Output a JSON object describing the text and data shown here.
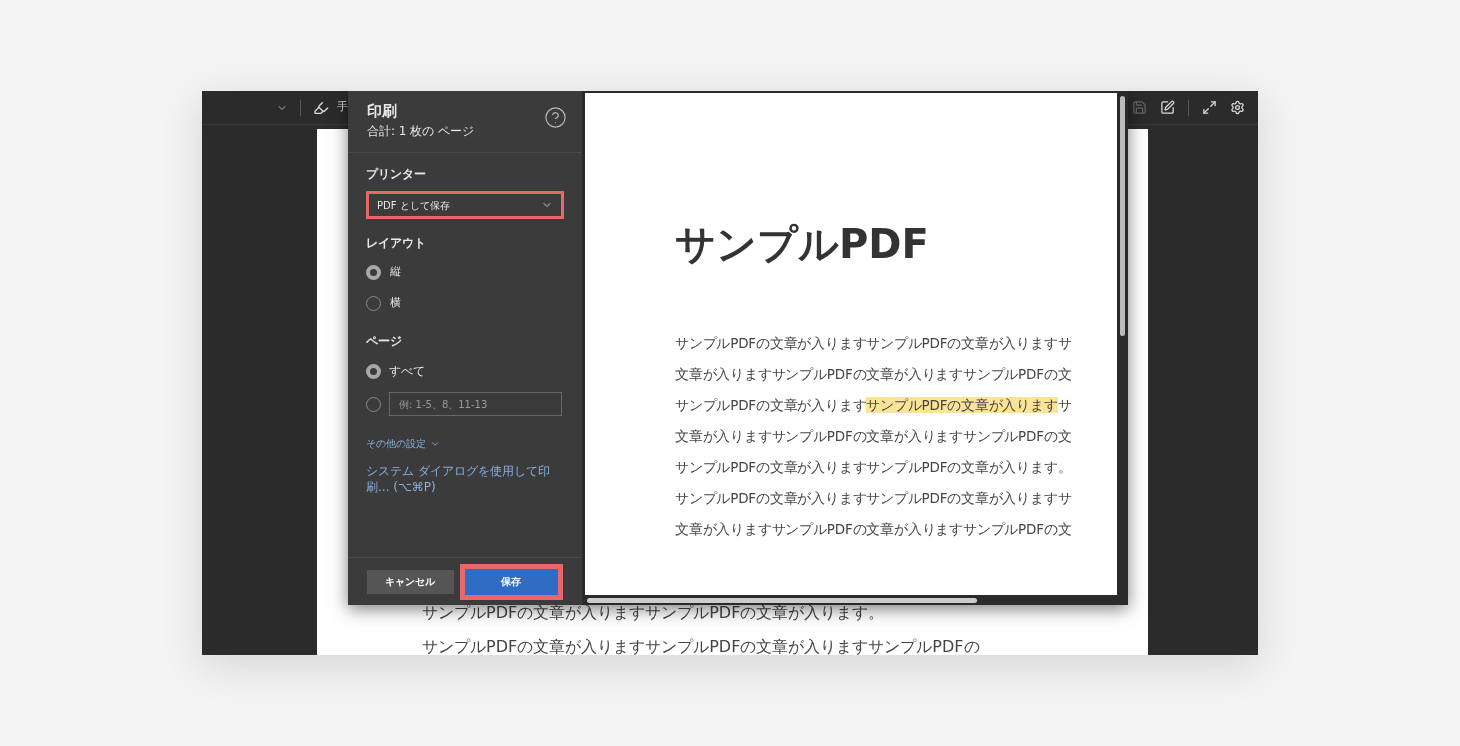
{
  "toolbar": {
    "draw_tool": {
      "label": "手"
    },
    "save": {
      "disabled": true
    }
  },
  "document": {
    "lines": [
      "サンプルPDFの文章が入りますサンプルPDFの文章が入ります。",
      "サンプルPDFの文章が入りますサンプルPDFの文章が入りますサンプルPDFの"
    ]
  },
  "print_dialog": {
    "title": "印刷",
    "subtitle": "合計: 1 枚の ページ",
    "printer": {
      "label": "プリンター",
      "value": "PDF として保存",
      "highlighted": true
    },
    "layout": {
      "label": "レイアウト",
      "options": [
        {
          "label": "縦",
          "selected": true
        },
        {
          "label": "横",
          "selected": false
        }
      ]
    },
    "pages": {
      "label": "ページ",
      "options": [
        {
          "kind": "all",
          "label": "すべて",
          "selected": true
        },
        {
          "kind": "range",
          "placeholder": "例: 1-5、8、11-13",
          "selected": false
        }
      ]
    },
    "more_settings": {
      "label": "その他の設定"
    },
    "system_dialog": {
      "label": "システム ダイアログを使用して印刷... (⌥⌘P)"
    },
    "buttons": [
      {
        "kind": "secondary",
        "label": "キャンセル",
        "highlighted": false
      },
      {
        "kind": "primary",
        "label": "保存",
        "highlighted": true
      }
    ],
    "preview": {
      "heading": "サンプルPDF",
      "lines": [
        {
          "segments": [
            {
              "text": "サンプルPDFの文章が入りますサンプルPDFの文章が入りますサ",
              "highlighted": false
            }
          ]
        },
        {
          "segments": [
            {
              "text": "文章が入りますサンプルPDFの文章が入りますサンプルPDFの文",
              "highlighted": false
            }
          ]
        },
        {
          "segments": [
            {
              "text": "サンプルPDFの文章が入ります",
              "highlighted": false
            },
            {
              "text": "サンプルPDFの文章が入ります",
              "highlighted": true
            },
            {
              "text": "サ",
              "highlighted": false
            }
          ]
        },
        {
          "segments": [
            {
              "text": "文章が入りますサンプルPDFの文章が入りますサンプルPDFの文",
              "highlighted": false
            }
          ]
        },
        {
          "segments": [
            {
              "text": "サンプルPDFの文章が入りますサンプルPDFの文章が入ります。",
              "highlighted": false
            }
          ]
        },
        {
          "segments": [
            {
              "text": "サンプルPDFの文章が入りますサンプルPDFの文章が入りますサ",
              "highlighted": false
            }
          ]
        },
        {
          "segments": [
            {
              "text": "文章が入りますサンプルPDFの文章が入りますサンプルPDFの文",
              "highlighted": false
            }
          ]
        }
      ]
    }
  }
}
